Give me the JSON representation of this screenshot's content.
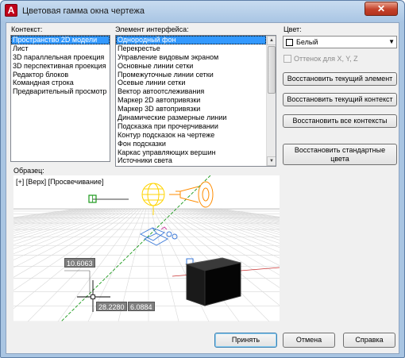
{
  "window": {
    "title": "Цветовая гамма окна чертежа",
    "close_glyph": "✕",
    "app_icon_letter": "A"
  },
  "context": {
    "label": "Контекст:",
    "items": [
      "Пространство 2D модели",
      "Лист",
      "3D параллельная проекция",
      "3D перспективная проекция",
      "Редактор блоков",
      "Командная строка",
      "Предварительный просмотр"
    ],
    "selected": 0
  },
  "interface": {
    "label": "Элемент интерфейса:",
    "items": [
      "Однородный фон",
      "Перекрестье",
      "Управление видовым экраном",
      "Основные линии сетки",
      "Промежуточные линии сетки",
      "Осевые линии сетки",
      "Вектор автоотслеживания",
      "Маркер 2D автопривязки",
      "Маркер 3D автопривязки",
      "Динамические размерные линии",
      "Подсказка при прочерчивании",
      "Контур подсказок на чертеже",
      "Фон подсказки",
      "Каркас управляющих вершин",
      "Источники света"
    ],
    "selected": 0,
    "scroll_up": "▲",
    "scroll_down": "▼"
  },
  "color": {
    "label": "Цвет:",
    "value": "Белый",
    "swatch": "#ffffff",
    "dropdown_glyph": "▼",
    "tint_label": "Оттенок для X, Y, Z",
    "tint_checked": false
  },
  "buttons": {
    "restore_element": "Восстановить текущий элемент",
    "restore_context": "Восстановить текущий контекст",
    "restore_all": "Восстановить все контексты",
    "restore_classic_1": "Восстановить стандартные",
    "restore_classic_2": "цвета",
    "accept": "Принять",
    "cancel": "Отмена",
    "help": "Справка"
  },
  "preview": {
    "label": "Образец:",
    "viewport_label": "[+] [Верх] [Просвечивание]",
    "dim_1": "10.6063",
    "dim_2": "28.2280",
    "dim_3": "6.0884"
  },
  "colors": {
    "accent_selection": "#3399ff",
    "title_bar": "#aac6e4",
    "light_yellow": "#ffe600",
    "light_orange": "#ff8c00",
    "camera_blue": "#3a78d8",
    "crosshair_green": "#1a9a1a",
    "axis_red": "#c83232"
  }
}
